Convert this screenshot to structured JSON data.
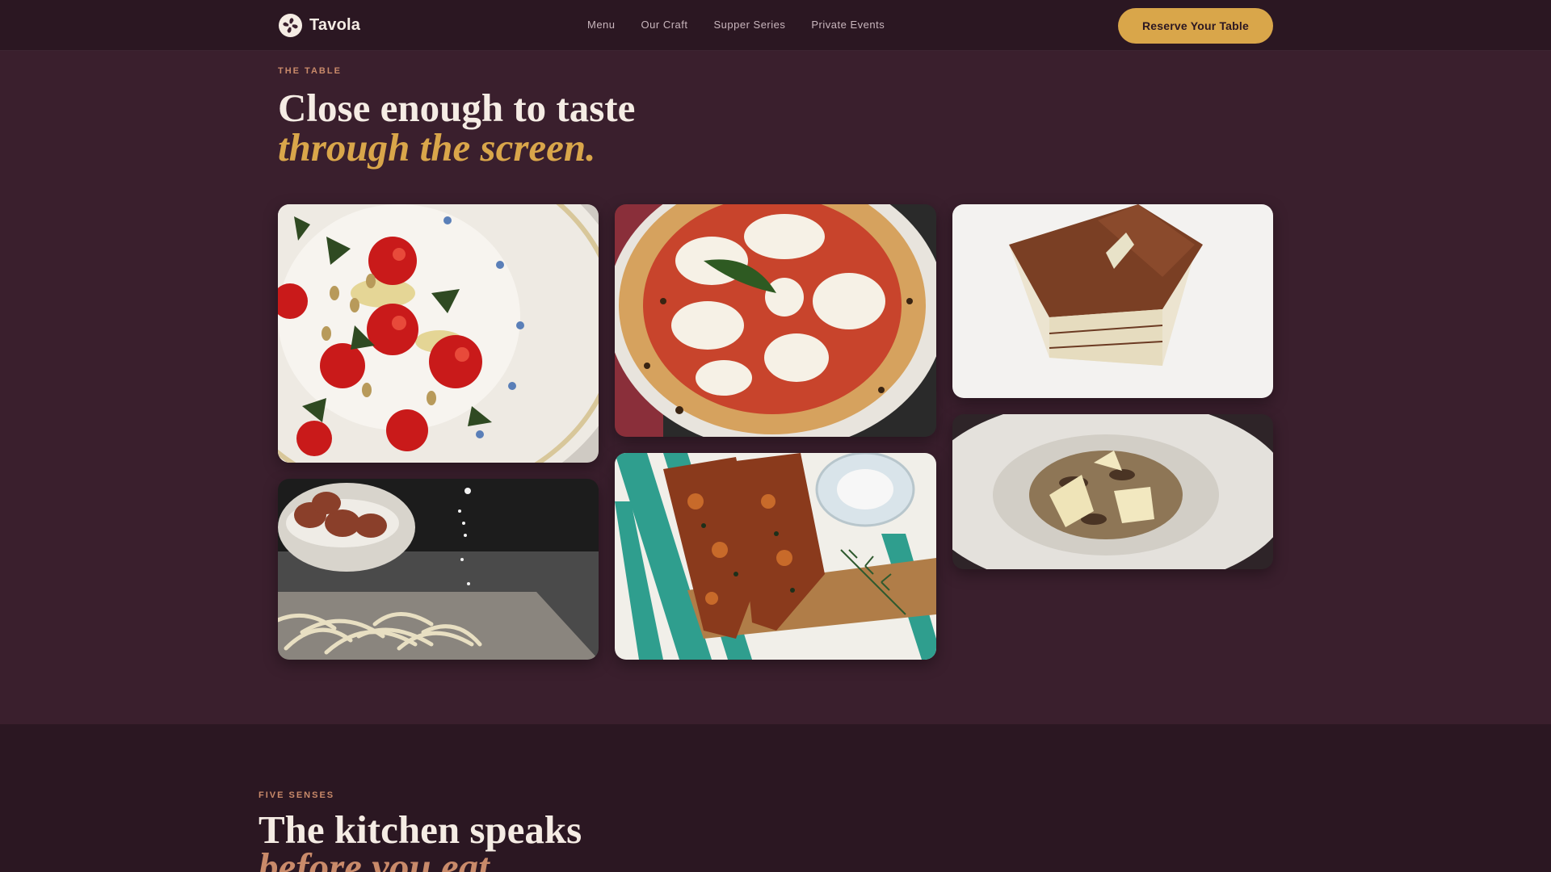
{
  "brand": {
    "name": "Tavola",
    "logo_icon": "flower-logo-icon"
  },
  "nav": {
    "links": [
      "Menu",
      "Our Craft",
      "Supper Series",
      "Private Events"
    ],
    "cta_label": "Reserve Your Table"
  },
  "gallery": {
    "eyebrow": "THE TABLE",
    "title_line1": "Close enough to taste",
    "title_line2": "through the screen.",
    "images": [
      "caprese-tomato-salad-photo",
      "margherita-pizza-photo",
      "tiramisu-photo",
      "fresh-pasta-eggs-photo",
      "focaccia-bread-photo",
      "mushroom-risotto-photo"
    ]
  },
  "senses": {
    "eyebrow": "FIVE SENSES",
    "title_line1": "The kitchen speaks",
    "title_line2": "before you eat."
  },
  "colors": {
    "background": "#3a1f2d",
    "nav_background": "#2b1722",
    "accent_gold": "#d9a64a",
    "accent_copper": "#c98a6a"
  }
}
